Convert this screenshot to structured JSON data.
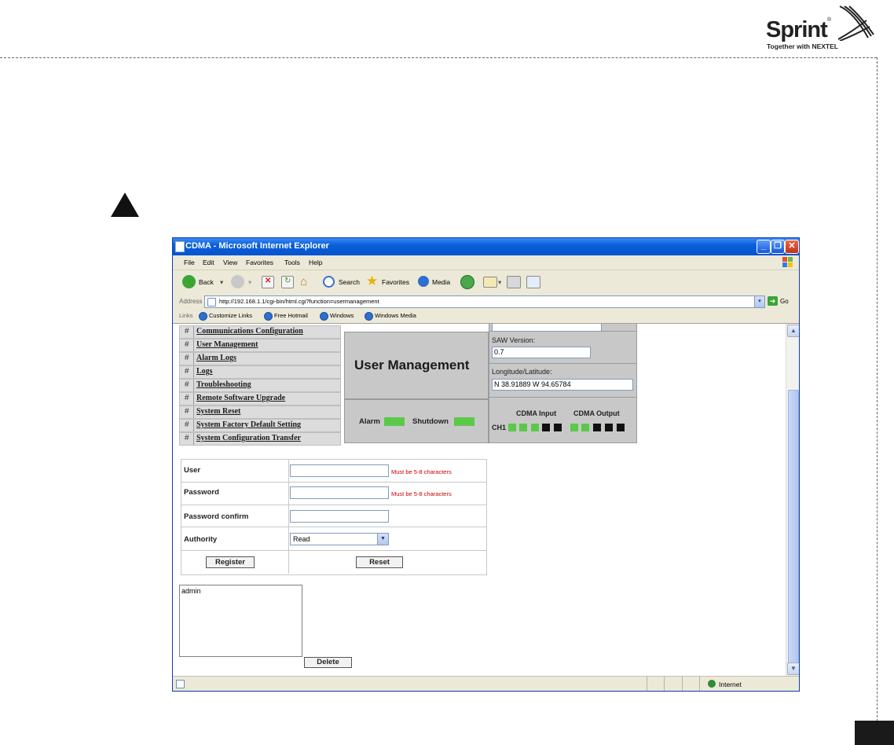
{
  "brand": {
    "name": "Sprint",
    "tagline": "Together with NEXTEL"
  },
  "window": {
    "title": "CDMA - Microsoft Internet Explorer"
  },
  "menu": [
    "File",
    "Edit",
    "View",
    "Favorites",
    "Tools",
    "Help"
  ],
  "toolbar": {
    "back": "Back",
    "search": "Search",
    "favorites": "Favorites",
    "media": "Media"
  },
  "address": {
    "label": "Address",
    "url": "http://192.168.1.1/cgi-bin/html.cgi?function=usermanagement",
    "go": "Go"
  },
  "links": {
    "label": "Links",
    "items": [
      "Customize Links",
      "Free Hotmail",
      "Windows",
      "Windows Media"
    ]
  },
  "nav": {
    "hash": "#",
    "items": [
      "Communications Configuration",
      "User Management",
      "Alarm Logs",
      "Logs",
      "Troubleshooting",
      "Remote Software Upgrade",
      "System Reset",
      "System Factory Default Setting",
      "System Configuration Transfer"
    ]
  },
  "page": {
    "title": "User Management"
  },
  "info": {
    "saw_label": "SAW Version:",
    "saw_value": "0.7",
    "lonlat_label": "Longitude/Latitude:",
    "lonlat_value": "N 38.91889 W 94.65784"
  },
  "status": {
    "alarm_label": "Alarm",
    "shutdown_label": "Shutdown",
    "cdma_input_label": "CDMA Input",
    "cdma_output_label": "CDMA Output",
    "channel_label": "CH1",
    "colors": {
      "ok": "#5cc84a",
      "off": "#111111"
    }
  },
  "form": {
    "user_label": "User",
    "user_hint": "Must be 5-8 characters",
    "password_label": "Password",
    "password_hint": "Must be 5-8 characters",
    "password_confirm_label": "Password confirm",
    "authority_label": "Authority",
    "authority_value": "Read",
    "register_label": "Register",
    "reset_label": "Reset"
  },
  "users": {
    "items": [
      "admin"
    ],
    "delete_label": "Delete"
  },
  "statusbar": {
    "zone": "Internet"
  }
}
